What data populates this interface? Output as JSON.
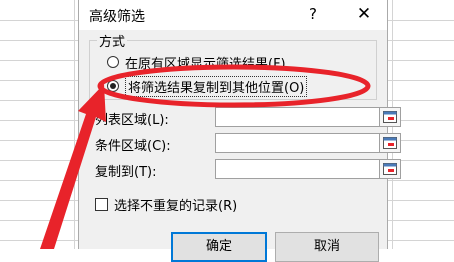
{
  "dialog": {
    "title": "高级筛选",
    "help_label": "?",
    "close_label": "✕",
    "group_label": "方式",
    "radio_in_place": "在原有区域显示筛选结果(F)",
    "radio_copy": "将筛选结果复制到其他位置(O)",
    "list_range_label": "列表区域(L):",
    "criteria_range_label": "条件区域(C):",
    "copy_to_label": "复制到(T):",
    "unique_label": "选择不重复的记录(R)",
    "ok_label": "确定",
    "cancel_label": "取消"
  },
  "colors": {
    "annotation": "#e8232a",
    "dialog_bg": "#f0f0f0",
    "focus_border": "#0078d7"
  },
  "icons": {
    "range_button": "collapse-range-icon",
    "help": "question-mark-icon",
    "close": "close-icon"
  }
}
